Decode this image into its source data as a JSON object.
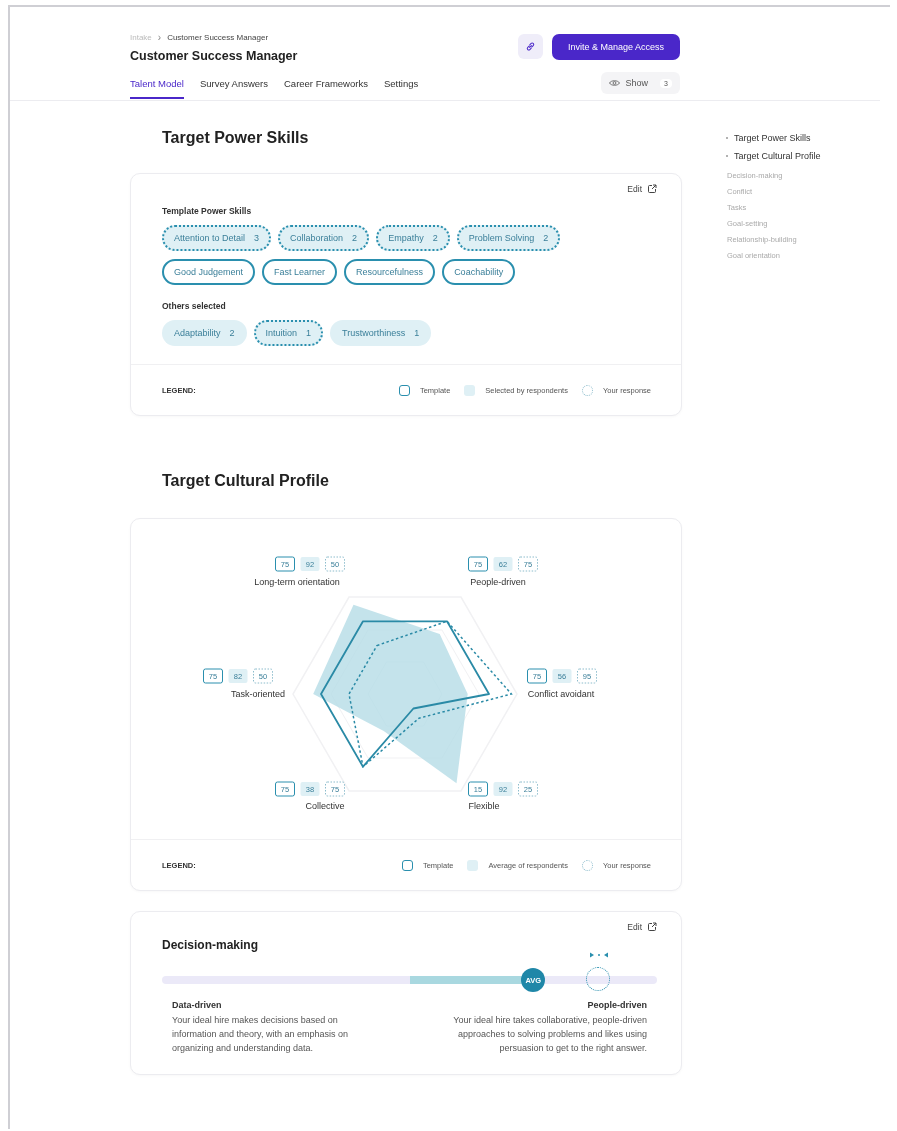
{
  "breadcrumb": [
    "Intake",
    "Customer Success Manager"
  ],
  "breadcrumb_separator": "›",
  "title": "Customer Success Manager",
  "invite_button": "Invite & Manage Access",
  "tabs": [
    {
      "label": "Talent Model",
      "selected": true
    },
    {
      "label": "Survey Answers",
      "selected": false
    },
    {
      "label": "Career Frameworks",
      "selected": false
    },
    {
      "label": "Settings",
      "selected": false
    }
  ],
  "show_button": {
    "label": "Show",
    "count": "3"
  },
  "power_skills": {
    "heading": "Target Power Skills",
    "edit": "Edit",
    "template_heading": "Template Power Skills",
    "template_skills": [
      {
        "label": "Attention to Detail",
        "count": "3",
        "your_response": true
      },
      {
        "label": "Collaboration",
        "count": "2",
        "your_response": true
      },
      {
        "label": "Empathy",
        "count": "2",
        "your_response": true
      },
      {
        "label": "Problem Solving",
        "count": "2",
        "your_response": true
      },
      {
        "label": "Good Judgement",
        "your_response": false
      },
      {
        "label": "Fast Learner",
        "your_response": false
      },
      {
        "label": "Resourcefulness",
        "your_response": false
      },
      {
        "label": "Coachability",
        "your_response": false
      }
    ],
    "others_heading": "Others selected",
    "other_skills": [
      {
        "label": "Adaptability",
        "count": "2",
        "your_response": false
      },
      {
        "label": "Intuition",
        "count": "1",
        "your_response": true
      },
      {
        "label": "Trustworthiness",
        "count": "1",
        "your_response": false
      }
    ],
    "legend": {
      "title": "LEGEND:",
      "items": [
        {
          "kind": "outline",
          "label": "Template"
        },
        {
          "kind": "filled",
          "label": "Selected by respondents"
        },
        {
          "kind": "dotted",
          "label": "Your response"
        }
      ]
    }
  },
  "cultural_profile": {
    "heading": "Target Cultural Profile",
    "axes": [
      {
        "label": "Long-term orientation",
        "template": "75",
        "average": "92",
        "yours": "50"
      },
      {
        "label": "People-driven",
        "template": "75",
        "average": "62",
        "yours": "75"
      },
      {
        "label": "Task-oriented",
        "template": "75",
        "average": "82",
        "yours": "50"
      },
      {
        "label": "Conflict avoidant",
        "template": "75",
        "average": "56",
        "yours": "95"
      },
      {
        "label": "Collective",
        "template": "75",
        "average": "38",
        "yours": "75"
      },
      {
        "label": "Flexible",
        "template": "15",
        "average": "92",
        "yours": "25"
      }
    ],
    "legend": {
      "title": "LEGEND:",
      "items": [
        {
          "kind": "outline",
          "label": "Template"
        },
        {
          "kind": "filled",
          "label": "Average of respondents"
        },
        {
          "kind": "dotted",
          "label": "Your response"
        }
      ]
    }
  },
  "decision_making": {
    "heading": "Decision-making",
    "edit": "Edit",
    "average": {
      "label": "AVG",
      "level": 0.75
    },
    "your_response": {
      "level": 0.88
    },
    "left": {
      "title": "Data-driven",
      "text": "Your ideal hire makes decisions based on information and theory, with an emphasis on organizing and understanding data."
    },
    "right": {
      "title": "People-driven",
      "text": "Your ideal hire takes collaborative, people-driven approaches to solving problems and likes using persuasion to get to the right answer."
    }
  },
  "outline": [
    {
      "label": "Target Power Skills"
    },
    {
      "label": "Target Cultural Profile",
      "children": [
        {
          "label": "Decision-making"
        },
        {
          "label": "Conflict"
        },
        {
          "label": "Tasks"
        },
        {
          "label": "Goal-setting"
        },
        {
          "label": "Relationship-building"
        },
        {
          "label": "Goal orientation"
        }
      ]
    }
  ]
}
